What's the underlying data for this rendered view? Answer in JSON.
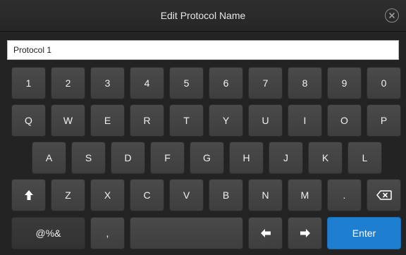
{
  "header": {
    "title": "Edit Protocol Name",
    "close_icon": "close-circle-icon"
  },
  "input": {
    "value": "Protocol 1"
  },
  "keyboard": {
    "row_numbers": [
      "1",
      "2",
      "3",
      "4",
      "5",
      "6",
      "7",
      "8",
      "9",
      "0"
    ],
    "row_q": [
      "Q",
      "W",
      "E",
      "R",
      "T",
      "Y",
      "U",
      "I",
      "O",
      "P"
    ],
    "row_a": [
      "A",
      "S",
      "D",
      "F",
      "G",
      "H",
      "J",
      "K",
      "L"
    ],
    "row_z": [
      "Z",
      "X",
      "C",
      "V",
      "B",
      "N",
      "M",
      "."
    ],
    "symbols_label": "@%&",
    "comma_label": ",",
    "enter_label": "Enter",
    "shift_icon": "shift-arrow-icon",
    "backspace_icon": "backspace-icon",
    "left_icon": "arrow-left-icon",
    "right_icon": "arrow-right-icon"
  },
  "colors": {
    "accent": "#1e7fd0",
    "key": "#444444",
    "background": "#232323"
  }
}
